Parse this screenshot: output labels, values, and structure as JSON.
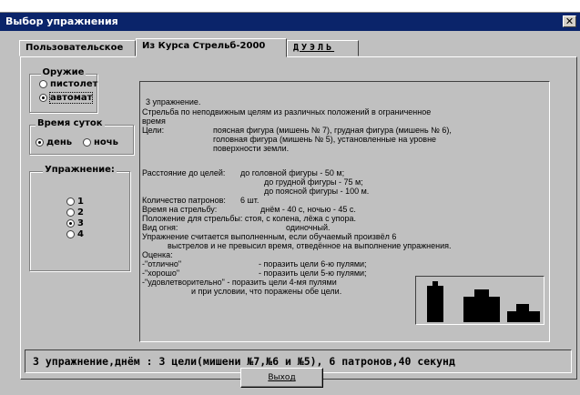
{
  "window": {
    "title": "Выбор упражнения",
    "close_label": "✕"
  },
  "tabs": [
    {
      "label": "Пользовательское"
    },
    {
      "label": "Из Курса Стрельб-2000"
    },
    {
      "label": "ДУЭЛЬ"
    }
  ],
  "weapon": {
    "title": "Оружие",
    "options": [
      "пистолет",
      "автомат"
    ],
    "selected": "автомат"
  },
  "time_of_day": {
    "title": "Время суток",
    "options": [
      "день",
      "ночь"
    ],
    "selected": "день"
  },
  "exercise": {
    "title": "Упражнение:",
    "options": [
      "1",
      "2",
      "3",
      "4"
    ],
    "selected": "3"
  },
  "description": {
    "lines": [
      "3 упражнение.",
      "Стрельба по неподвижным целям из различных положений в ограниченное",
      "время",
      "Цели:",
      "поясная фигура (мишень № 7), грудная фигура (мишень № 6),",
      "головная фигура (мишень № 5), установленные на уровне",
      "поверхности земли.",
      "Расстояние до целей:",
      "до головной фигуры - 50 м;",
      "до грудной фигуры  - 75 м;",
      "до поясной фигуры - 100 м.",
      "Количество патронов:",
      "6 шт.",
      "Время на стрельбу:",
      "днём - 40 с, ночью - 45 с.",
      "Положение для стрельбы: стоя, с колена, лёжа с упора.",
      "Вид огня:",
      "одиночный.",
      "Упражнение считается выполненным, если обучаемый произвёл 6",
      "выстрелов и не превысил время, отведённое на выполнение упражнения.",
      "Оценка:",
      "-\"отлично\"",
      "- поразить цели 6-ю  пулями;",
      "-\"хорошо\"",
      "- поразить цели 5-ю  пулями;",
      "-\"удовлетворительно\" - поразить цели 4-мя пулями",
      "и при условии, что поражены обе   цели."
    ]
  },
  "summary": {
    "text": "3 упражнение,днём  : 3 цели(мишени №7,№6 и №5), 6 патронов,40 секунд"
  },
  "exit_button": {
    "label": "Выход"
  }
}
